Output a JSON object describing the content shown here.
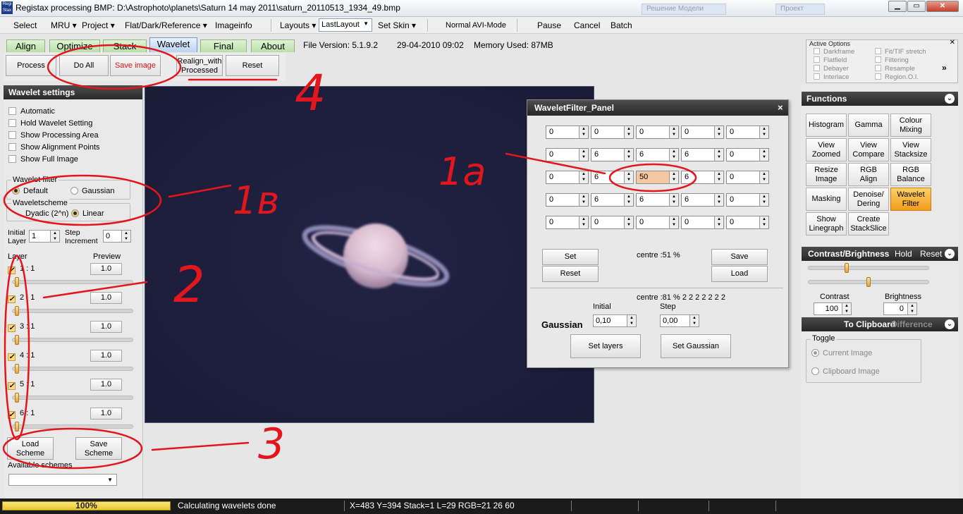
{
  "window": {
    "title": "Registax processing BMP: D:\\Astrophoto\\planets\\Saturn 14 may 2011\\saturn_20110513_1934_49.bmp",
    "logo_text": "Regi Stax",
    "bg_tab_1": "Решение Модели",
    "bg_tab_2": "Проект"
  },
  "menu": {
    "select": "Select",
    "mru": "MRU",
    "project": "Project",
    "flat": "Flat/Dark/Reference",
    "imageinfo": "Imageinfo",
    "layouts": "Layouts",
    "layout_value": "LastLayout",
    "skin": "Set Skin",
    "avimode": "Normal AVI-Mode",
    "pause": "Pause",
    "cancel": "Cancel",
    "batch": "Batch"
  },
  "tabs": {
    "align": "Align",
    "optimize": "Optimize",
    "stack": "Stack",
    "wavelet": "Wavelet",
    "final": "Final",
    "about": "About"
  },
  "info": {
    "version": "File Version: 5.1.9.2",
    "date": "29-04-2010 09:02",
    "memory": "Memory Used: 87MB"
  },
  "toolbar": {
    "process": "Process",
    "doall": "Do All",
    "saveimage": "Save image",
    "realign": "Realign_with\nProcessed",
    "reset": "Reset"
  },
  "active_options": {
    "title": "Active Options",
    "items": [
      "Darkframe",
      "Fit/TIF stretch",
      "Flatfield",
      "Filtering",
      "Debayer",
      "Resample",
      "Interlace",
      "Region.O.I."
    ]
  },
  "wavelet": {
    "title": "Wavelet settings",
    "checks": [
      "Automatic",
      "Hold Wavelet Setting",
      "Show Processing Area",
      "Show Alignment Points",
      "Show Full Image"
    ],
    "filter_label": "Wavelet filter",
    "default": "Default",
    "gaussian": "Gaussian",
    "scheme_label": "Waveletscheme",
    "dyadic": "Dyadic (2^n)",
    "linear": "Linear",
    "initial_label": "Initial\nLayer",
    "initial_value": "1",
    "step_label": "Step\nIncrement",
    "step_value": "0",
    "layer_header": "Layer",
    "preview_header": "Preview",
    "layers": [
      {
        "label": "1 : 1",
        "preview": "1.0"
      },
      {
        "label": "2 : 1",
        "preview": "1.0"
      },
      {
        "label": "3 : 1",
        "preview": "1.0"
      },
      {
        "label": "4 : 1",
        "preview": "1.0"
      },
      {
        "label": "5 : 1",
        "preview": "1.0"
      },
      {
        "label": "6 : 1",
        "preview": "1.0"
      }
    ],
    "load": "Load\nScheme",
    "save": "Save\nScheme",
    "available": "Available schemes"
  },
  "filter_panel": {
    "title": "WaveletFilter_Panel",
    "close": "×",
    "grid": [
      [
        "0",
        "0",
        "0",
        "0",
        "0"
      ],
      [
        "0",
        "6",
        "6",
        "6",
        "0"
      ],
      [
        "0",
        "6",
        "50",
        "6",
        "0"
      ],
      [
        "0",
        "6",
        "6",
        "6",
        "0"
      ],
      [
        "0",
        "0",
        "0",
        "0",
        "0"
      ]
    ],
    "set": "Set",
    "reset": "Reset",
    "save": "Save",
    "load": "Load",
    "centre1": "centre :51 %",
    "centre2": "centre :81 % 2 2 2 2 2 2 2",
    "gaussian": "Gaussian",
    "initial": "Initial",
    "step": "Step",
    "initial_value": "0,10",
    "step_value": "0,00",
    "setlayers": "Set layers",
    "setgaussian": "Set Gaussian"
  },
  "functions": {
    "title": "Functions",
    "buttons": [
      [
        "Histogram",
        "Gamma",
        "Colour\nMixing"
      ],
      [
        "View\nZoomed",
        "View\nCompare",
        "View\nStacksize"
      ],
      [
        "Resize\nImage",
        "RGB\nAlign",
        "RGB\nBalance"
      ],
      [
        "Masking",
        "Denoise/\nDering",
        "Wavelet\nFilter"
      ],
      [
        "Show\nLinegraph",
        "Create\nStackSlice",
        ""
      ]
    ]
  },
  "contrast": {
    "title": "Contrast/Brightness",
    "hold": "Hold",
    "reset": "Reset",
    "contrast_label": "Contrast",
    "brightness_label": "Brightness",
    "contrast_value": "100",
    "brightness_value": "0",
    "slider1": 0.32,
    "slider2": 0.5
  },
  "clipboard": {
    "to": "To Clipboard",
    "diff": "Difference",
    "toggle": "Toggle",
    "current": "Current Image",
    "clip": "Clipboard Image"
  },
  "status": {
    "progress": "100%",
    "message": "Calculating wavelets done",
    "coords": "X=483 Y=394 Stack=1 L=29 RGB=21 26 60"
  },
  "annotations": {
    "n1a": "1a",
    "n1b": "1в",
    "n2": "2",
    "n3": "3",
    "n4": "4"
  }
}
